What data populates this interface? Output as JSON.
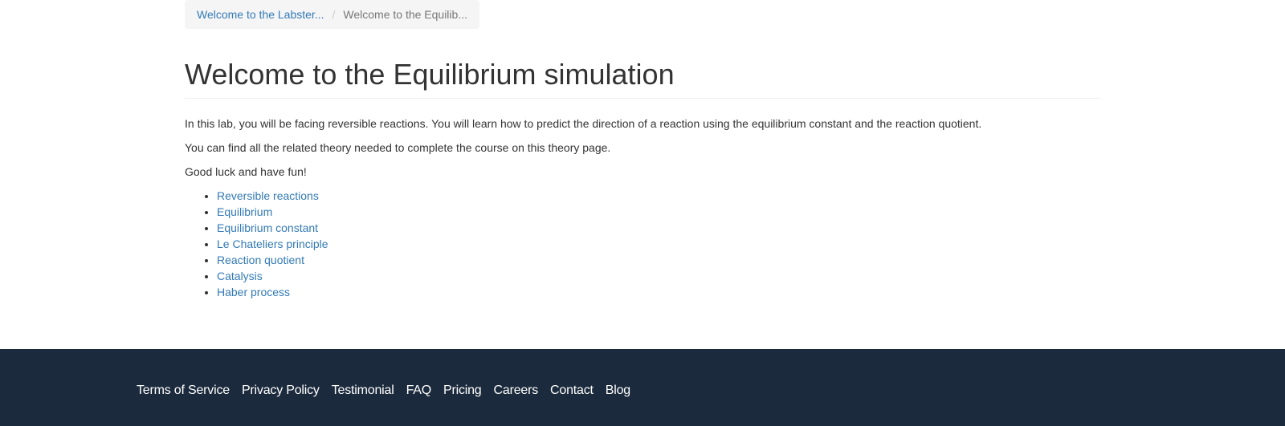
{
  "breadcrumb": {
    "items": [
      {
        "label": "Welcome to the Labster..."
      },
      {
        "label": "Welcome to the Equilib..."
      }
    ],
    "separator": "/"
  },
  "page": {
    "title": "Welcome to the Equilibrium simulation",
    "paragraphs": [
      "In this lab, you will be facing reversible reactions. You will learn how to predict the direction of a reaction using the equilibrium constant and the reaction quotient.",
      "You can find all the related theory needed to complete the course on this theory page.",
      "Good luck and have fun!"
    ],
    "links": [
      "Reversible reactions",
      "Equilibrium",
      "Equilibrium constant",
      "Le Chateliers principle",
      "Reaction quotient",
      "Catalysis",
      "Haber process"
    ]
  },
  "footer": {
    "links": [
      "Terms of Service",
      "Privacy Policy",
      "Testimonial",
      "FAQ",
      "Pricing",
      "Careers",
      "Contact",
      "Blog"
    ]
  },
  "colors": {
    "link": "#337ab7",
    "footer_bg": "#1b2a3c",
    "breadcrumb_bg": "#f5f5f5"
  }
}
